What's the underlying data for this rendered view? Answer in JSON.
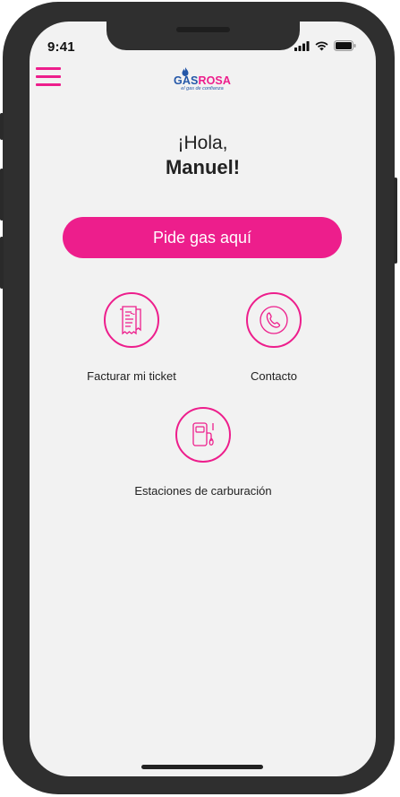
{
  "status_bar": {
    "time": "9:41"
  },
  "header": {
    "logo": {
      "brand_part1": "GAS",
      "brand_part2": "ROSA",
      "tagline": "el gas de confianza"
    }
  },
  "greeting": {
    "line1": "¡Hola,",
    "line2": "Manuel!"
  },
  "cta": {
    "label": "Pide gas aquí"
  },
  "features": [
    {
      "label": "Facturar mi ticket",
      "icon": "invoice-icon"
    },
    {
      "label": "Contacto",
      "icon": "phone-icon"
    },
    {
      "label": "Estaciones de carburación",
      "icon": "fuel-pump-icon"
    }
  ],
  "colors": {
    "accent": "#ed1e8c",
    "brand_blue": "#2457a8",
    "background": "#f2f2f2",
    "device": "#2f2f2f"
  }
}
